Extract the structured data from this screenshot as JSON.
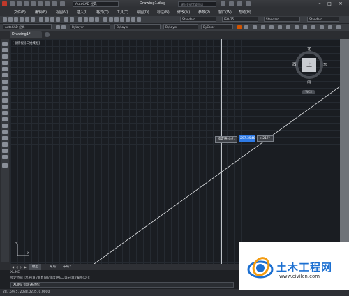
{
  "titlebar": {
    "workspace": "AutoCAD 经典",
    "document_title": "Drawing1.dwg",
    "search_placeholder": "键入关键字或短语"
  },
  "menu": {
    "items": [
      "文件(F)",
      "编辑(E)",
      "视图(V)",
      "插入(I)",
      "格式(O)",
      "工具(T)",
      "绘图(D)",
      "标注(N)",
      "修改(M)",
      "参数(P)",
      "窗口(W)",
      "帮助(H)"
    ]
  },
  "toolbar2": {
    "workspace_combo": "AutoCAD 经典",
    "text_style": "Standard",
    "dim_style": "ISO-25",
    "table_style": "Standard",
    "mleader_style": "Standard"
  },
  "toolbar3": {
    "color": "ByLayer",
    "linetype": "ByLayer",
    "lineweight": "ByLayer",
    "plotstyle": "ByColor"
  },
  "tabs": {
    "drawing": "Drawing1*"
  },
  "viewport": {
    "label": "[-][俯视][二维线框]"
  },
  "viewcube": {
    "north": "北",
    "south": "南",
    "east": "东",
    "west": "西",
    "face": "上",
    "wcs": "WCS"
  },
  "dynamic_input": {
    "prompt": "指定通过点:",
    "value": "297.3546",
    "angle": "< 217°"
  },
  "layout_tabs": {
    "model": "模型",
    "layout1": "布局1",
    "layout2": "布局2"
  },
  "command": {
    "line1": "XLINE",
    "line2": "指定点或 [水平(H)/垂直(V)/角度(A)/二等分(B)/偏移(O)]:",
    "input": "XLINE 指定通过点:"
  },
  "status": {
    "coords": "287.5945, 2088.0235, 0.0000"
  },
  "watermark": {
    "title": "土木工程网",
    "url": "www.civilcn.com"
  },
  "colors": {
    "canvas_bg": "#1a1d22",
    "crosshair": "#bfc3c8",
    "accent_blue": "#2e7ae6"
  }
}
